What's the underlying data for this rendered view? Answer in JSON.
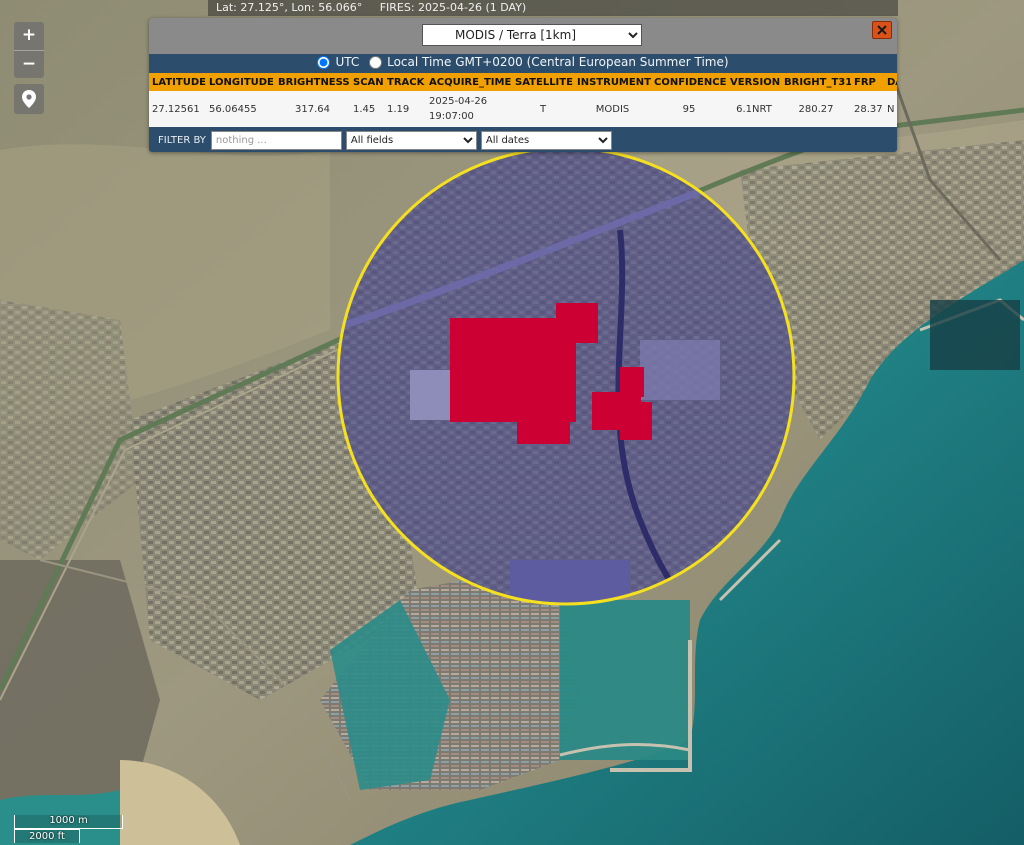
{
  "status": {
    "coords": "Lat: 27.125°, Lon: 56.066°",
    "fires": "FIRES: 2025-04-26 (1 DAY)"
  },
  "controls": {
    "zoom_in": "+",
    "zoom_out": "−"
  },
  "panel": {
    "product": "MODIS / Terra [1km]",
    "timezone_utc": "UTC",
    "timezone_local": "Local Time GMT+0200 (Central European Summer Time)",
    "utc_selected": true,
    "columns": [
      "LATITUDE",
      "LONGITUDE",
      "BRIGHTNESS",
      "SCAN",
      "TRACK",
      "ACQUIRE_TIME",
      "SATELLITE",
      "INSTRUMENT",
      "CONFIDENCE",
      "VERSION",
      "BRIGHT_T31",
      "FRP",
      "DAYNIGHT"
    ],
    "row": {
      "latitude": "27.12561",
      "longitude": "56.06455",
      "brightness": "317.64",
      "scan": "1.45",
      "track": "1.19",
      "acquire_date": "2025-04-26",
      "acquire_time": "19:07:00",
      "satellite": "T",
      "instrument": "MODIS",
      "confidence": "95",
      "version": "6.1NRT",
      "bright_t31": "280.27",
      "frp": "28.37",
      "daynight": "N"
    },
    "filter": {
      "label": "FILTER BY",
      "placeholder": "nothing ...",
      "field_select": "All fields",
      "date_select": "All dates"
    }
  },
  "scale": {
    "metric": "1000 m",
    "imperial": "2000 ft"
  },
  "colors": {
    "fire": "#cc0033",
    "buffer_ring": "#f5e020",
    "panel_header": "#f0a000",
    "panel_bg": "#2c4e6c"
  }
}
